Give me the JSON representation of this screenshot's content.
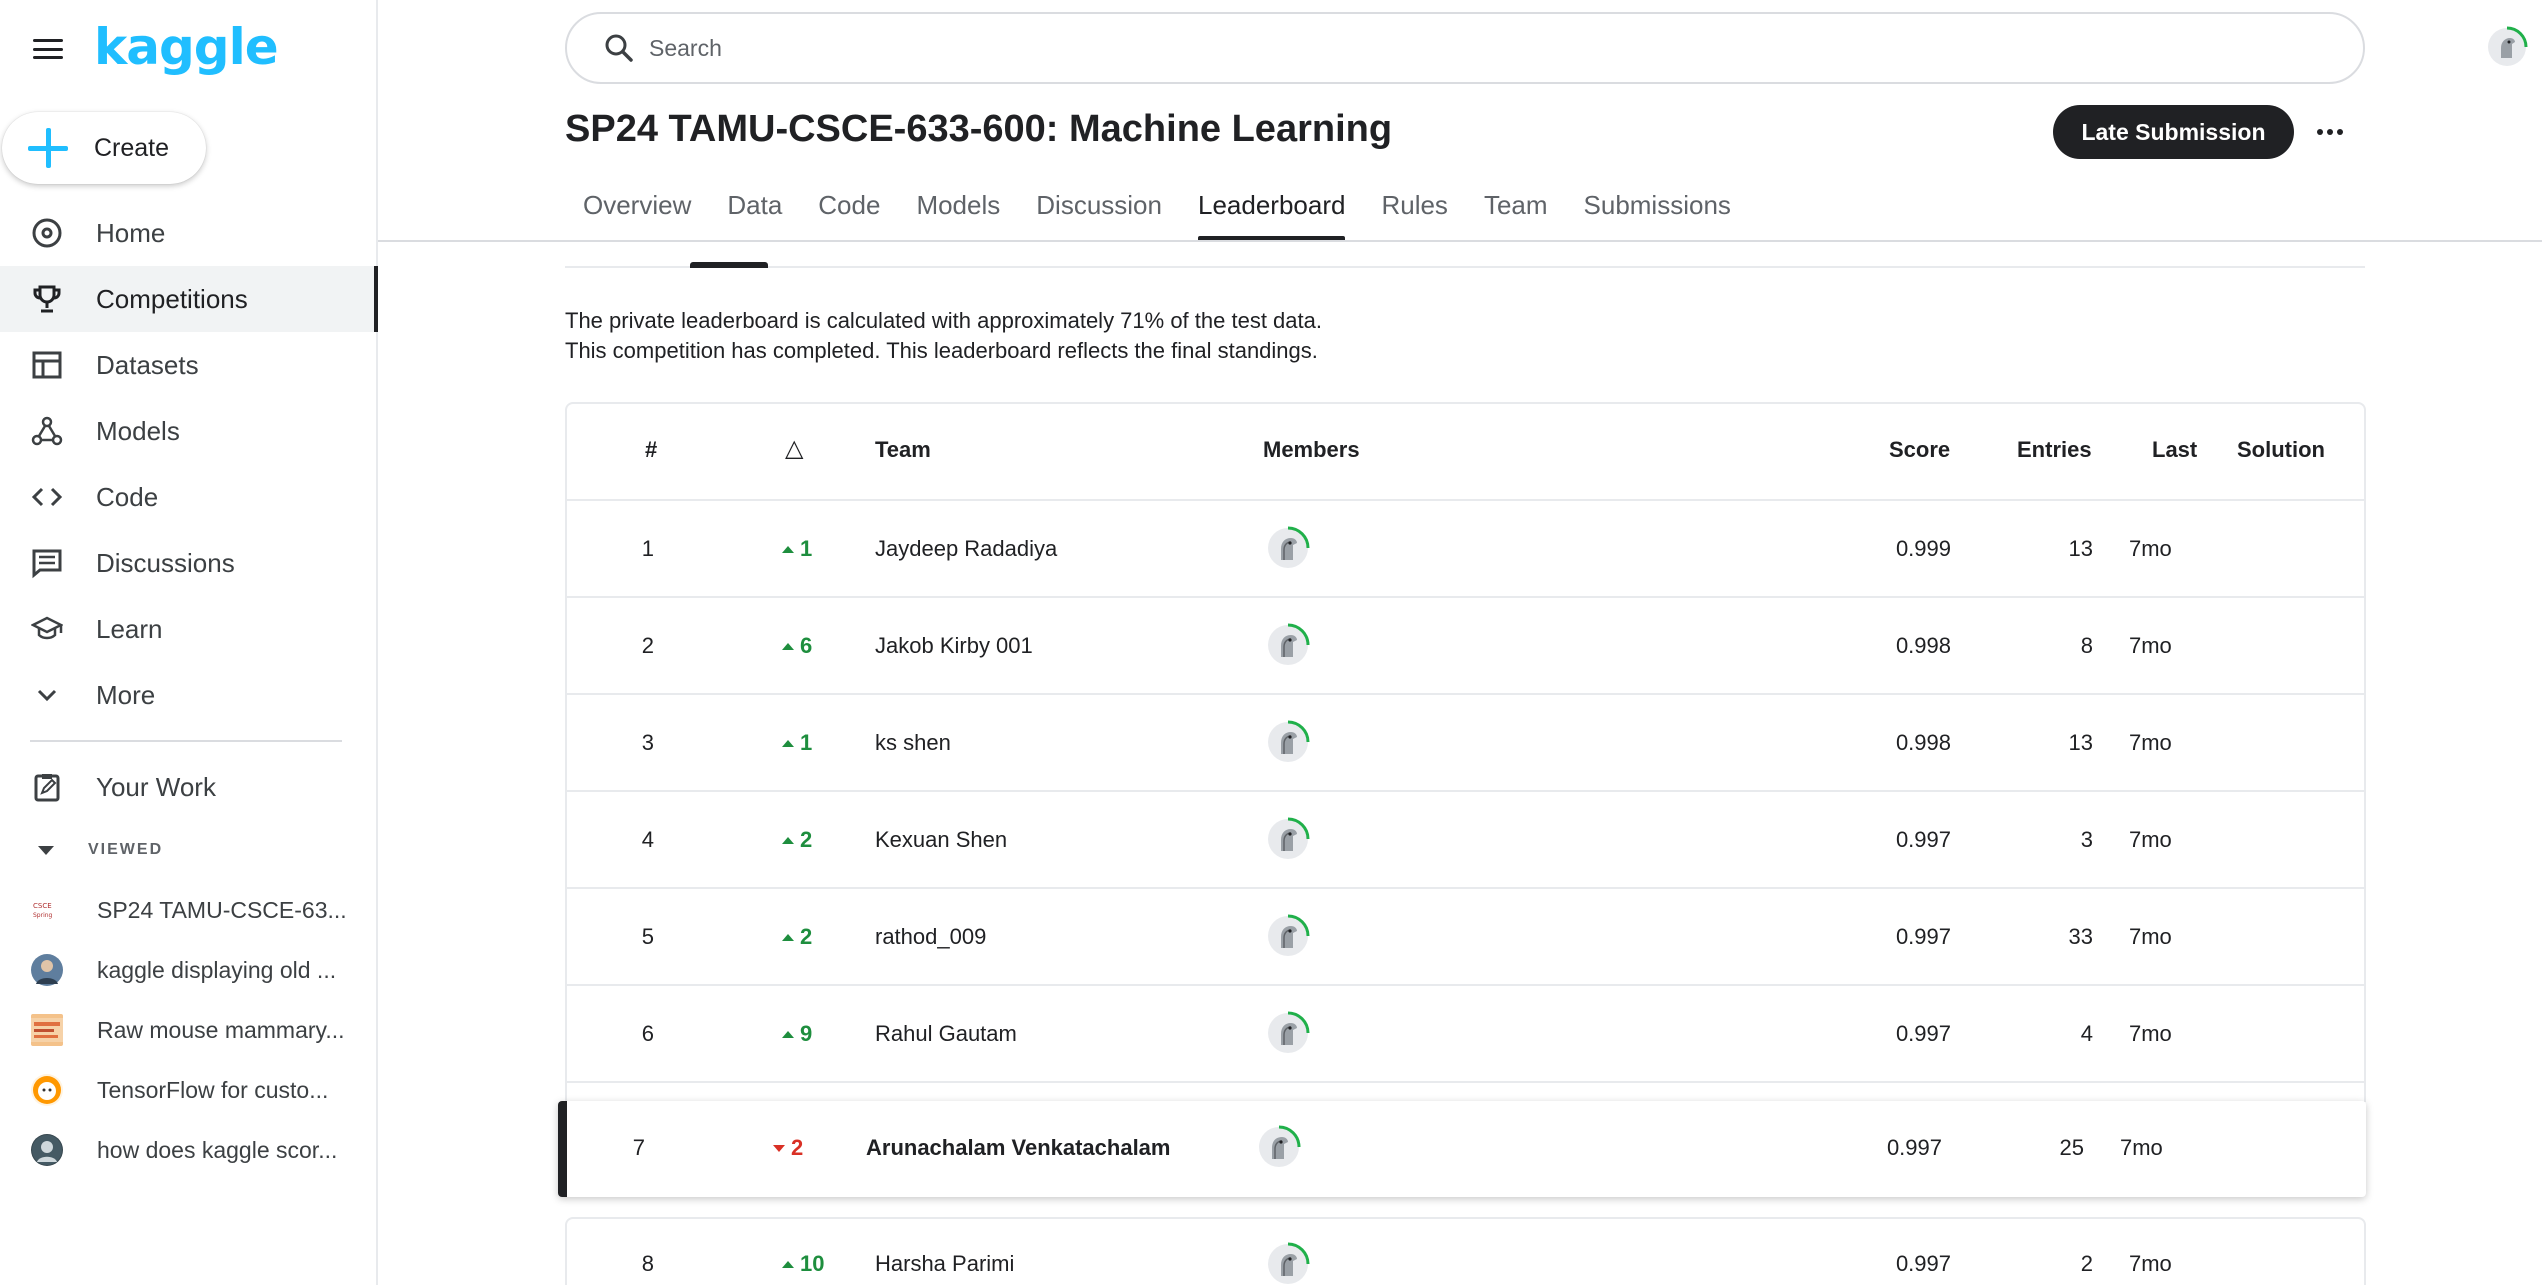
{
  "brand": {
    "logo": "kaggle"
  },
  "sidebar": {
    "create_label": "Create",
    "items": [
      {
        "label": "Home",
        "icon": "compass-icon",
        "active": false
      },
      {
        "label": "Competitions",
        "icon": "trophy-icon",
        "active": true
      },
      {
        "label": "Datasets",
        "icon": "table-icon",
        "active": false
      },
      {
        "label": "Models",
        "icon": "models-icon",
        "active": false
      },
      {
        "label": "Code",
        "icon": "code-icon",
        "active": false
      },
      {
        "label": "Discussions",
        "icon": "comments-icon",
        "active": false
      },
      {
        "label": "Learn",
        "icon": "school-icon",
        "active": false
      },
      {
        "label": "More",
        "icon": "chevron-down-icon",
        "active": false
      }
    ],
    "your_work": "Your Work",
    "viewed_heading": "VIEWED",
    "viewed": [
      {
        "label": "SP24 TAMU-CSCE-63...",
        "thumb": "competition-thumb"
      },
      {
        "label": "kaggle displaying old ...",
        "thumb": "user-avatar"
      },
      {
        "label": "Raw mouse mammary...",
        "thumb": "dataset-thumb"
      },
      {
        "label": "TensorFlow for custo...",
        "thumb": "user-avatar"
      },
      {
        "label": "how does kaggle scor...",
        "thumb": "user-avatar"
      }
    ]
  },
  "search": {
    "placeholder": "Search"
  },
  "competition": {
    "title": "SP24 TAMU-CSCE-633-600: Machine Learning",
    "late_submission_label": "Late Submission",
    "tabs": [
      "Overview",
      "Data",
      "Code",
      "Models",
      "Discussion",
      "Leaderboard",
      "Rules",
      "Team",
      "Submissions"
    ],
    "active_tab": "Leaderboard"
  },
  "leaderboard": {
    "info_line1": "The private leaderboard is calculated with approximately 71% of the test data.",
    "info_line2": "This competition has completed. This leaderboard reflects the final standings.",
    "headers": {
      "rank": "#",
      "move": "△",
      "team": "Team",
      "members": "Members",
      "score": "Score",
      "entries": "Entries",
      "last": "Last",
      "solution": "Solution"
    },
    "rows": [
      {
        "rank": "1",
        "move": "1",
        "dir": "up",
        "team": "Jaydeep Radadiya",
        "score": "0.999",
        "entries": "13",
        "last": "7mo"
      },
      {
        "rank": "2",
        "move": "6",
        "dir": "up",
        "team": "Jakob Kirby 001",
        "score": "0.998",
        "entries": "8",
        "last": "7mo"
      },
      {
        "rank": "3",
        "move": "1",
        "dir": "up",
        "team": "ks shen",
        "score": "0.998",
        "entries": "13",
        "last": "7mo"
      },
      {
        "rank": "4",
        "move": "2",
        "dir": "up",
        "team": "Kexuan Shen",
        "score": "0.997",
        "entries": "3",
        "last": "7mo"
      },
      {
        "rank": "5",
        "move": "2",
        "dir": "up",
        "team": "rathod_009",
        "score": "0.997",
        "entries": "33",
        "last": "7mo"
      },
      {
        "rank": "6",
        "move": "9",
        "dir": "up",
        "team": "Rahul Gautam",
        "score": "0.997",
        "entries": "4",
        "last": "7mo"
      }
    ],
    "highlight_row": {
      "rank": "7",
      "move": "2",
      "dir": "down",
      "team": "Arunachalam Venkatachalam",
      "score": "0.997",
      "entries": "25",
      "last": "7mo"
    },
    "row8": {
      "rank": "8",
      "move": "10",
      "dir": "up",
      "team": "Harsha Parimi",
      "score": "0.997",
      "entries": "2",
      "last": "7mo"
    }
  },
  "colors": {
    "accent": "#20beff",
    "up": "#1e8e3e",
    "down": "#d93025",
    "primary_button": "#202124"
  }
}
